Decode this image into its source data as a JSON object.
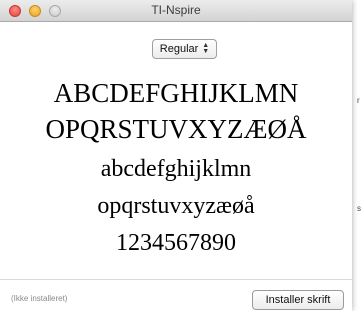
{
  "window": {
    "title": "TI-Nspire"
  },
  "style_selector": {
    "value": "Regular"
  },
  "preview": {
    "uppercase_1": "ABCDEFGHIJKLMN",
    "uppercase_2": "OPQRSTUVXYZÆØÅ",
    "lowercase_1": "abcdefghijklmn",
    "lowercase_2": "opqrstuvxyzæøå",
    "digits": "1234567890"
  },
  "footer": {
    "status": "(Ikke installeret)",
    "install_label": "Installer skrift"
  },
  "background": {
    "letter_1": "r",
    "letter_2": "s"
  }
}
